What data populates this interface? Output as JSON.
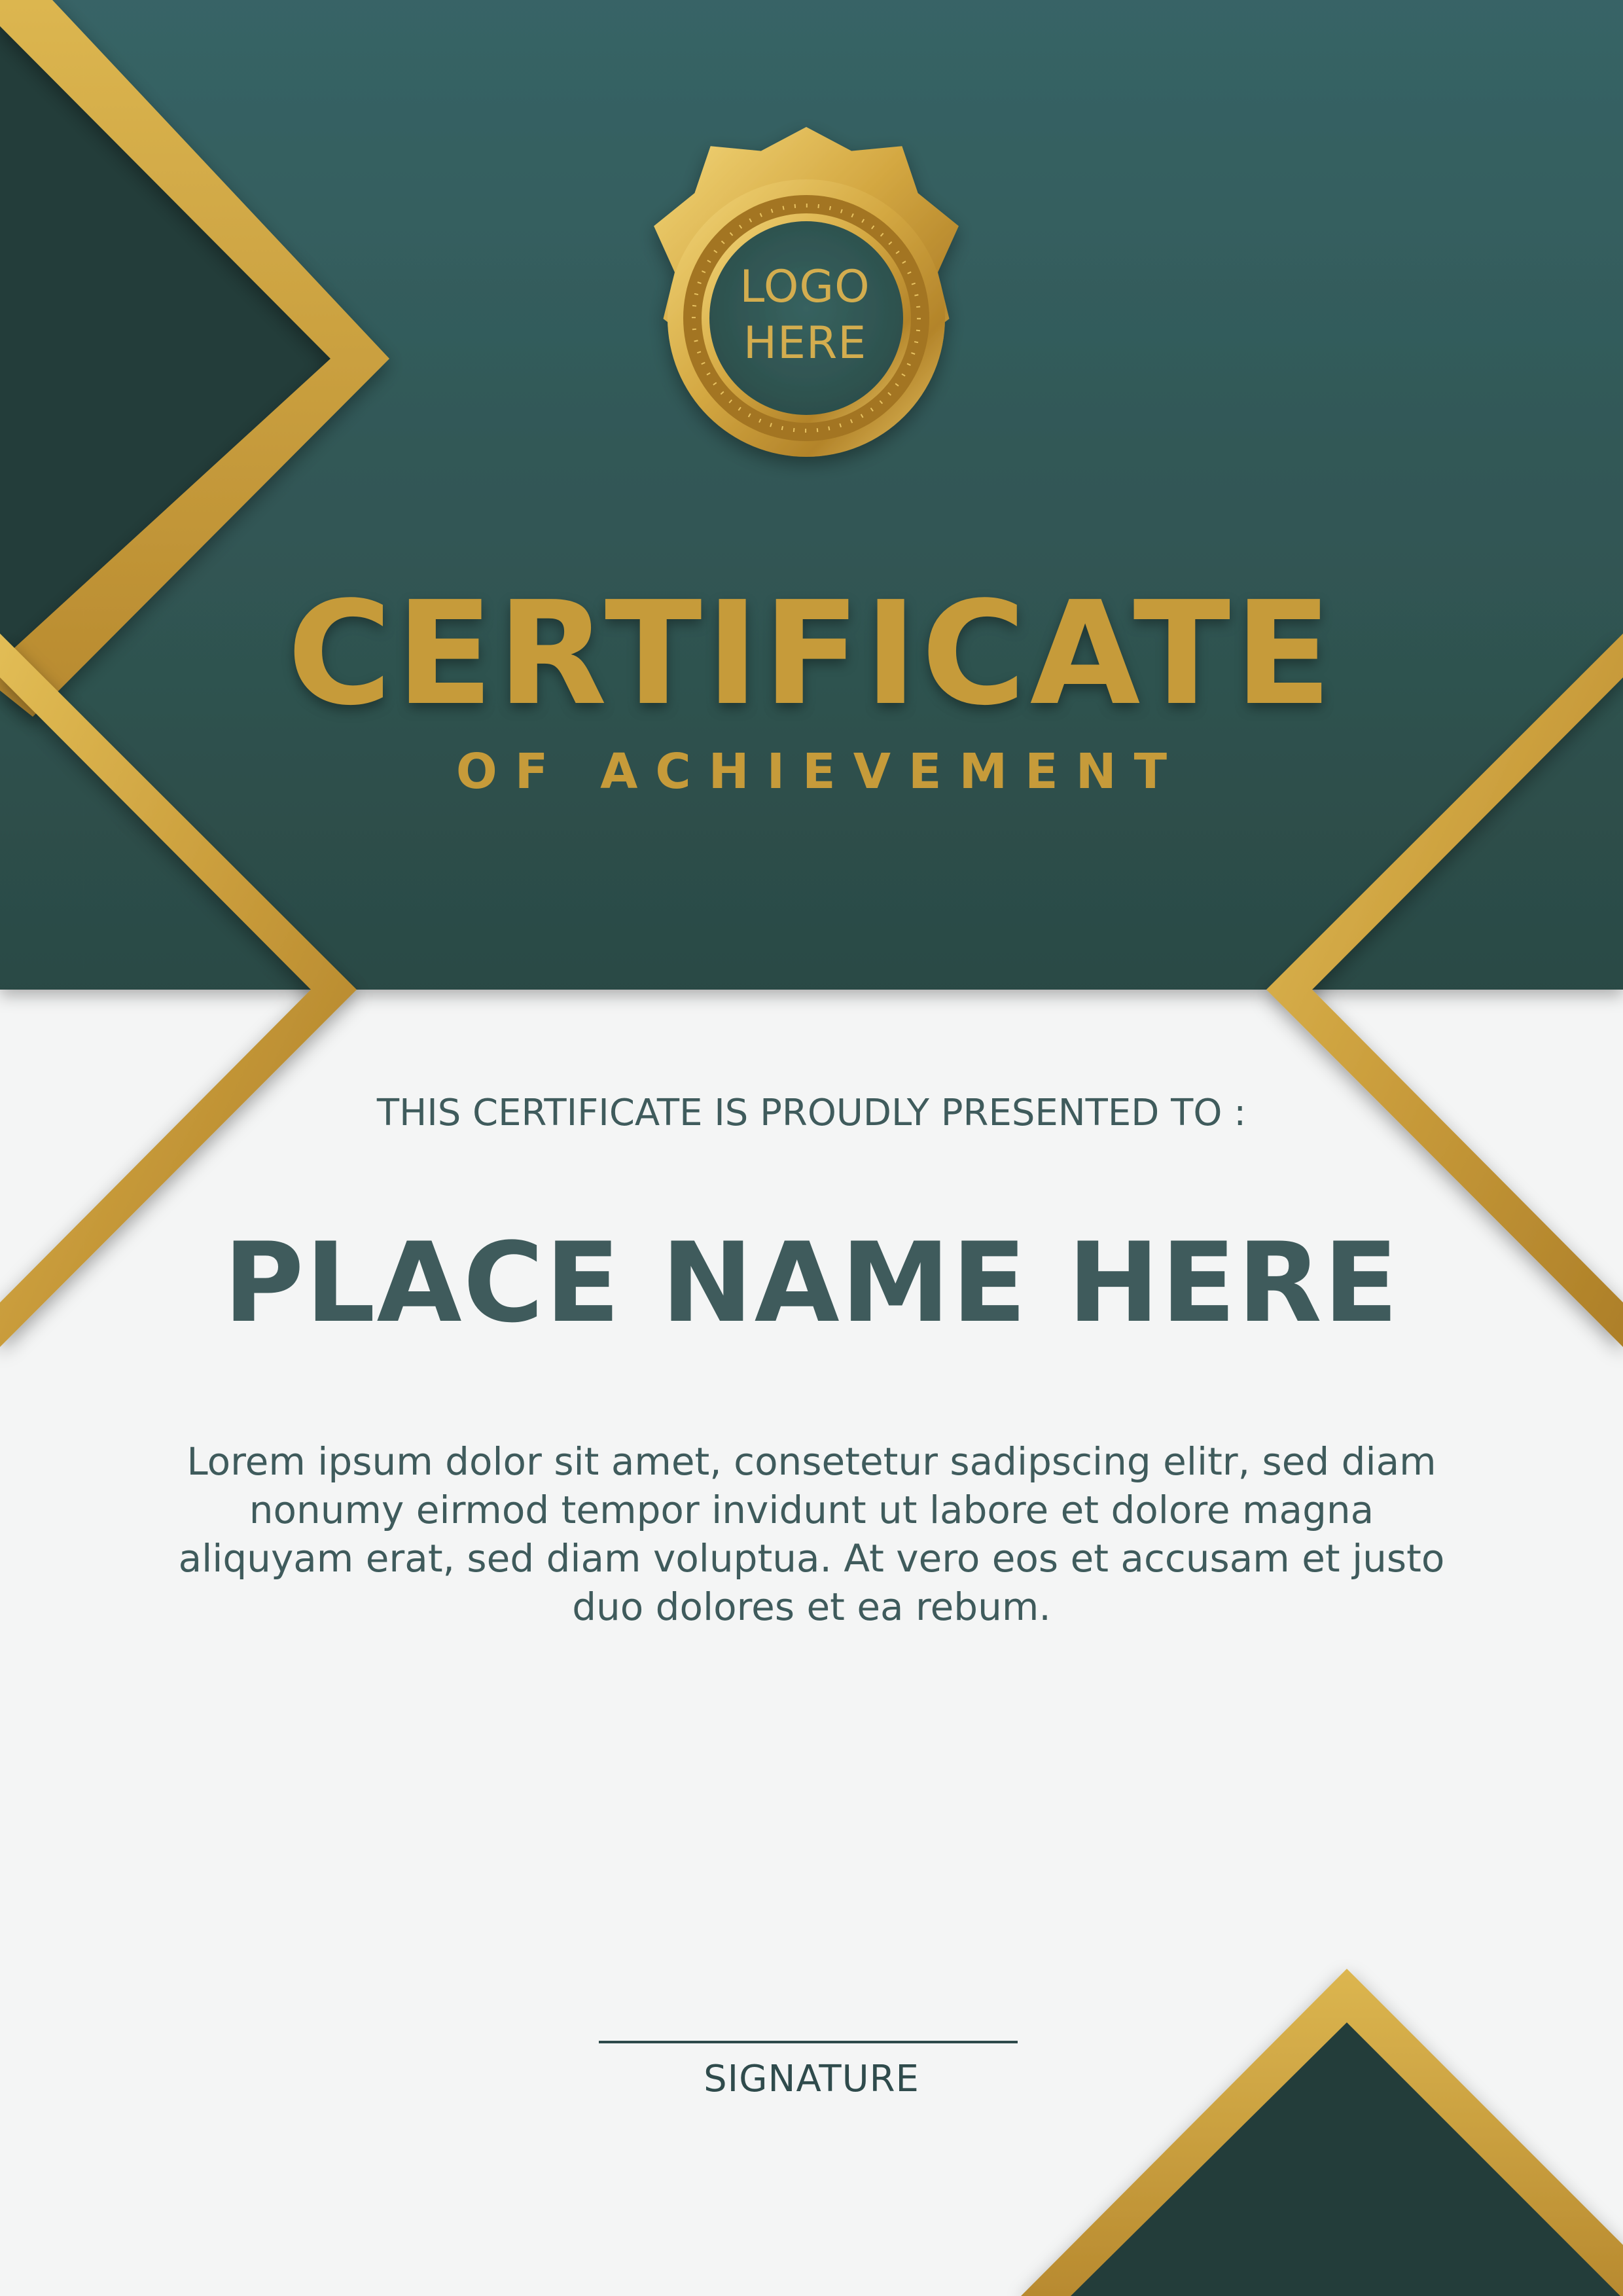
{
  "certificate": {
    "logo_line_1": "LOGO",
    "logo_line_2": "HERE",
    "title": "CERTIFICATE",
    "subtitle": "OF ACHIEVEMENT",
    "presented_to": "THIS CERTIFICATE IS PROUDLY PRESENTED TO :",
    "recipient_name": "PLACE NAME HERE",
    "body": "Lorem ipsum dolor sit amet, consetetur sadipscing elitr,  sed diam nonumy eirmod tempor invidunt ut labore et dolore magna aliquyam erat, sed diam voluptua. At vero eos et accusam et justo duo dolores et ea rebum.",
    "signature_label": "SIGNATURE"
  },
  "colors": {
    "teal_dark": "#264241",
    "teal_header": "#33605f",
    "gold": "#c69b3a",
    "gold_light": "#e2bd55",
    "text": "#3f5b5c",
    "background": "#f4f5f5"
  },
  "icons": {
    "seal": "gold-star-seal-icon"
  }
}
